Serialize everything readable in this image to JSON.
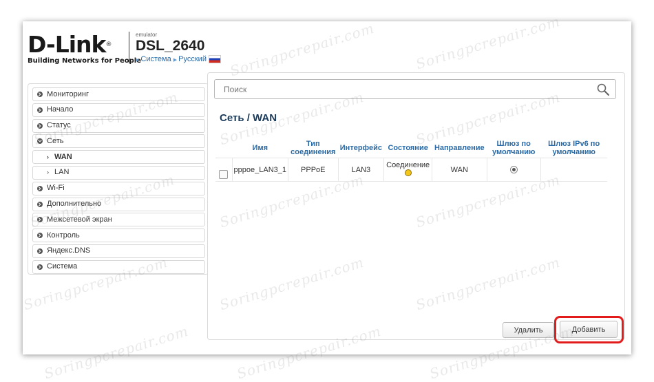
{
  "brand": {
    "logo": "D-Link",
    "registered": "®",
    "tagline": "Building Networks for People",
    "emulator_label": "emulator",
    "model": "DSL_2640",
    "crumb_system": "Система",
    "crumb_language": "Русский"
  },
  "sidebar": {
    "items": [
      {
        "label": "Мониторинг"
      },
      {
        "label": "Начало"
      },
      {
        "label": "Статус"
      },
      {
        "label": "Сеть"
      },
      {
        "label": "WAN"
      },
      {
        "label": "LAN"
      },
      {
        "label": "Wi-Fi"
      },
      {
        "label": "Дополнительно"
      },
      {
        "label": "Межсетевой экран"
      },
      {
        "label": "Контроль"
      },
      {
        "label": "Яндекс.DNS"
      },
      {
        "label": "Система"
      }
    ]
  },
  "search": {
    "placeholder": "Поиск"
  },
  "page": {
    "title": "Сеть /  WAN"
  },
  "table": {
    "headers": {
      "name": "Имя",
      "type": "Тип соединения",
      "iface": "Интерфейс",
      "state": "Состояние",
      "direction": "Направление",
      "gateway": "Шлюз по умолчанию",
      "gateway6": "Шлюз IPv6 по умолчанию"
    },
    "rows": [
      {
        "name": "pppoe_LAN3_1",
        "type": "PPPoE",
        "iface": "LAN3",
        "state": "Соединение",
        "direction": "WAN"
      }
    ]
  },
  "buttons": {
    "delete": "Удалить",
    "add": "Добавить"
  },
  "watermark": "Soringpcrepair.com",
  "colors": {
    "accent": "#2a6aa6",
    "highlight": "#e21b1b",
    "status_dot": "#f3c61a"
  }
}
